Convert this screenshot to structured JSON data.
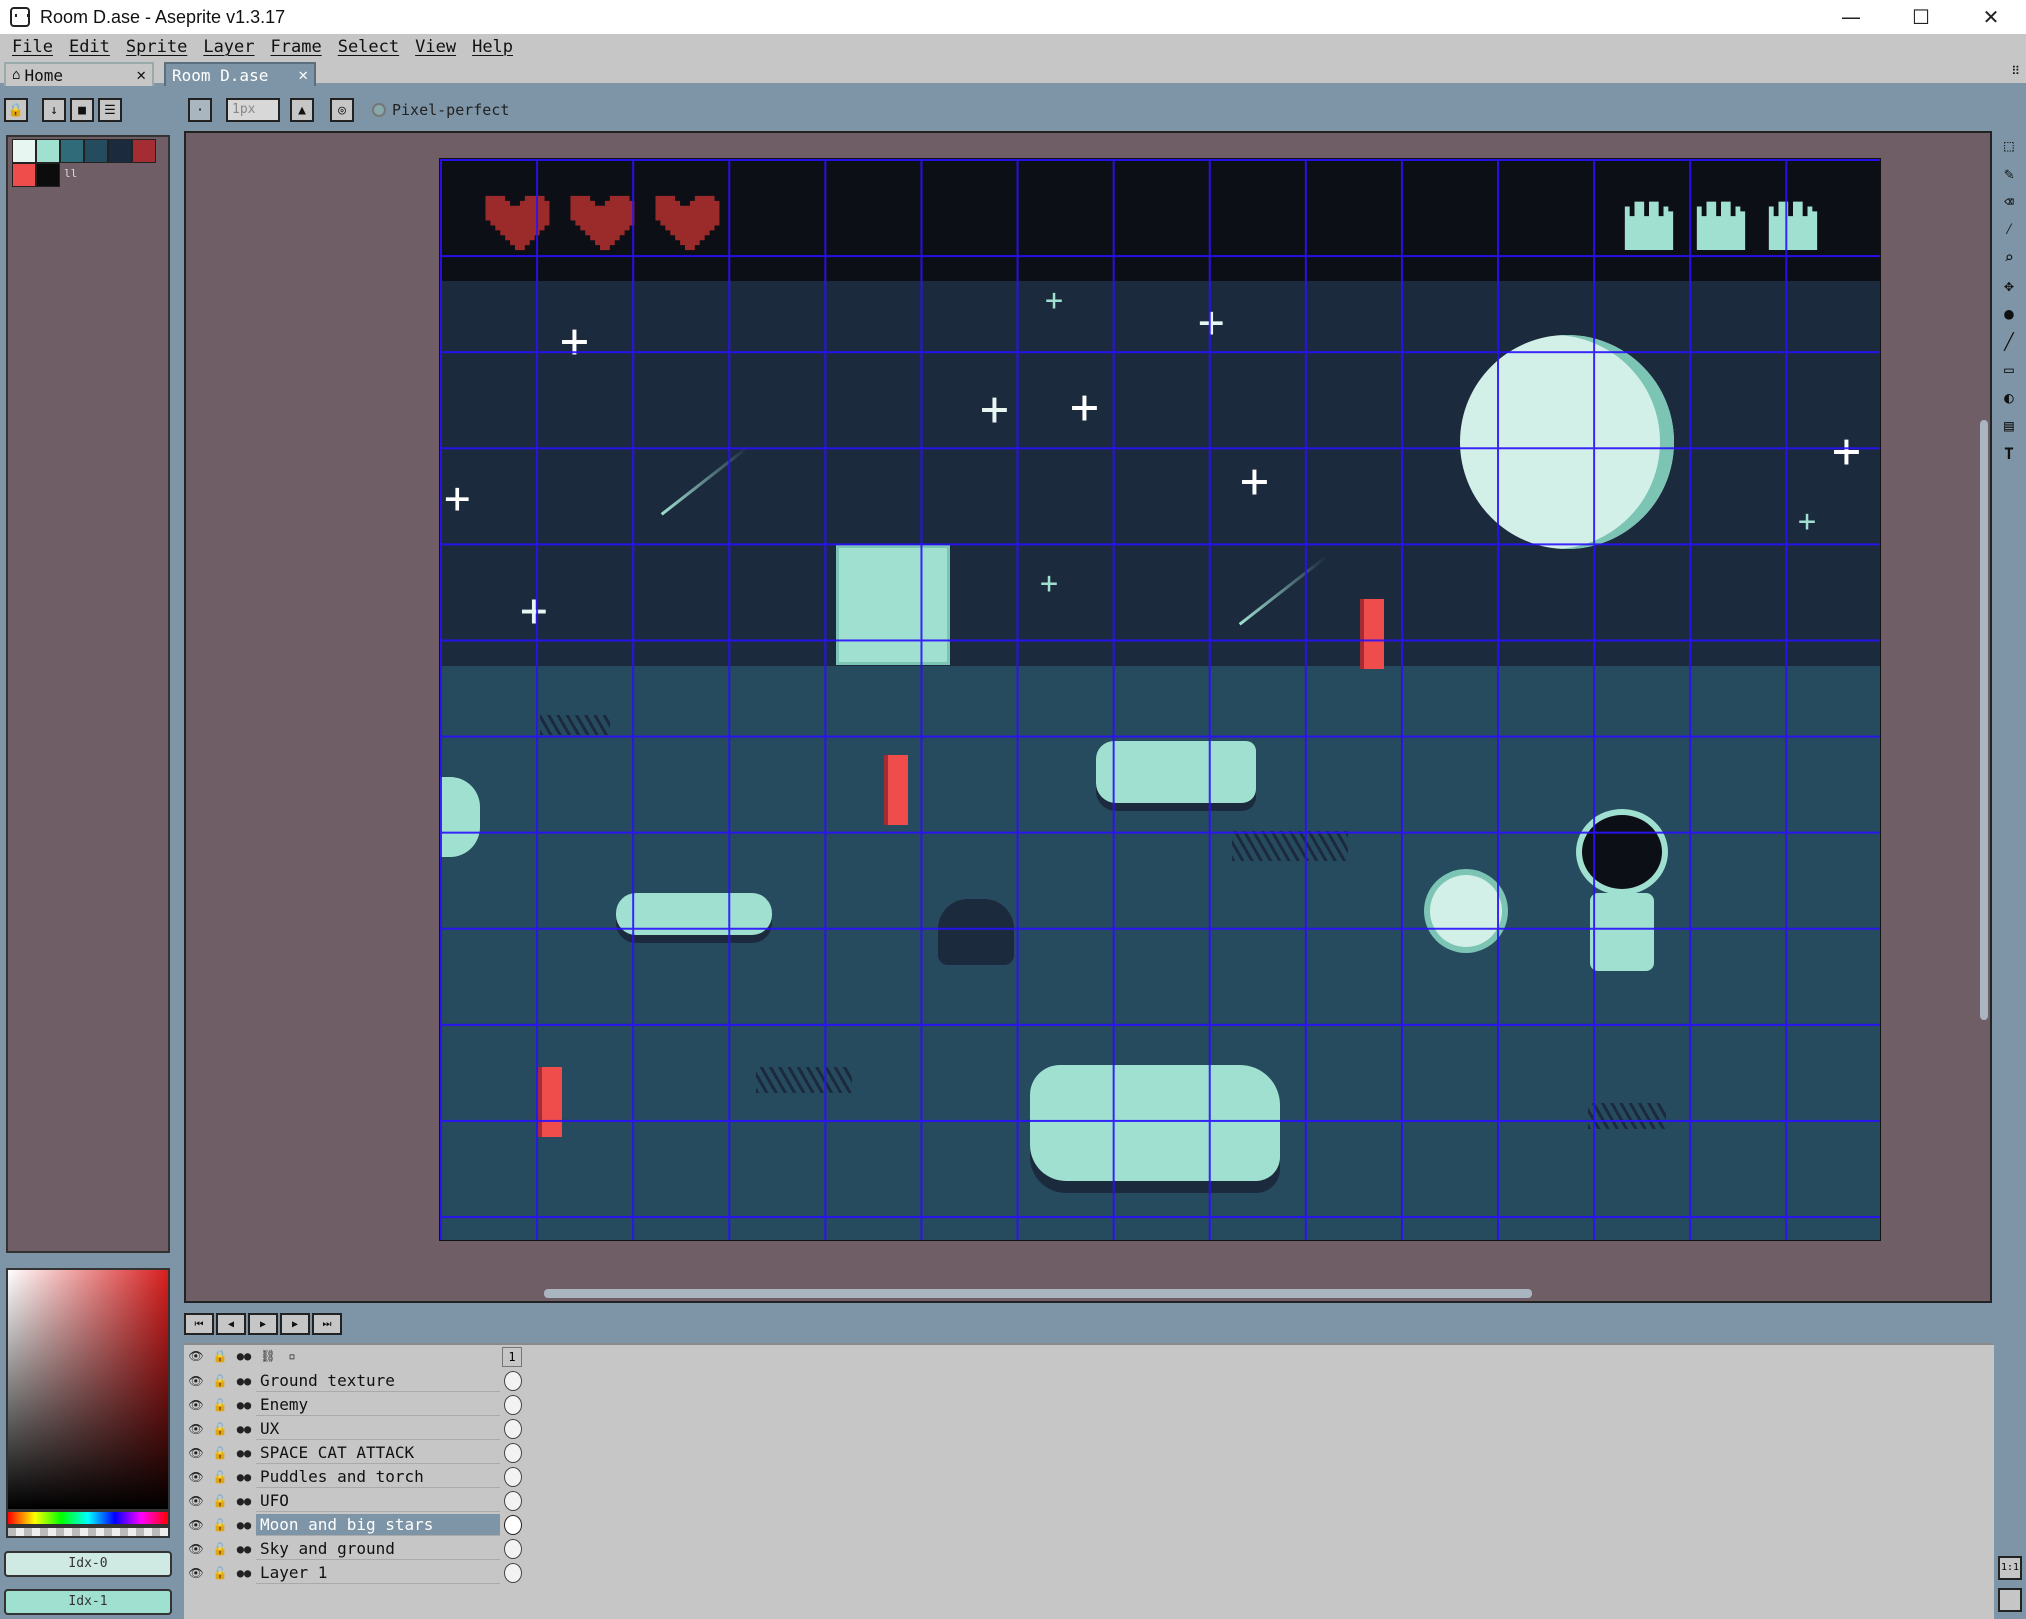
{
  "window": {
    "title": "Room D.ase - Aseprite v1.3.17",
    "minimize": "—",
    "maximize": "☐",
    "close": "✕"
  },
  "menu": [
    "File",
    "Edit",
    "Sprite",
    "Layer",
    "Frame",
    "Select",
    "View",
    "Help"
  ],
  "tabs": [
    {
      "label": "Home",
      "close": "✕"
    },
    {
      "label": "Room D.ase",
      "close": "✕"
    }
  ],
  "toolbar": {
    "brush_size_placeholder": "1px",
    "pixel_perfect_label": "Pixel-perfect"
  },
  "palette": {
    "colors": [
      "#e8f6f2",
      "#9fe0d0",
      "#2f6b78",
      "#254b5e",
      "#1c2a3e",
      "#a32d33",
      "#ef4c4c",
      "#0c0c0c"
    ],
    "index_label": "ll"
  },
  "color_buttons": [
    "Idx-0",
    "Idx-1"
  ],
  "hud": {
    "hearts": 3,
    "lives": 3,
    "heart_color": "#9b2a2a",
    "life_color": "#9fe0d0"
  },
  "tools": [
    "selection-tool",
    "pencil-tool",
    "eraser-tool",
    "eyedropper-tool",
    "zoom-tool",
    "move-tool",
    "fill-tool",
    "line-tool",
    "rectangle-tool",
    "ellipse-tool",
    "blur-tool",
    "text-tool"
  ],
  "timeline": {
    "frame": "1",
    "layers": [
      {
        "name": "Ground texture",
        "selected": false
      },
      {
        "name": "Enemy",
        "selected": false
      },
      {
        "name": "UX",
        "selected": false
      },
      {
        "name": "SPACE CAT ATTACK",
        "selected": false
      },
      {
        "name": "Puddles and torch",
        "selected": false
      },
      {
        "name": "UFO",
        "selected": false
      },
      {
        "name": "Moon and big stars",
        "selected": true
      },
      {
        "name": "Sky and ground",
        "selected": false
      },
      {
        "name": "Layer 1",
        "selected": false
      }
    ]
  },
  "zoom_label": "1:1"
}
